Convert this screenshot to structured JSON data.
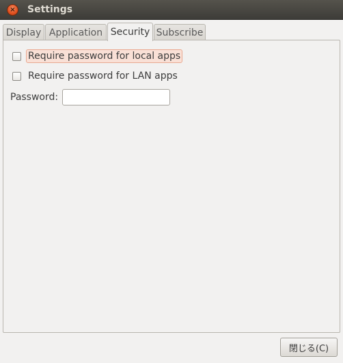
{
  "window": {
    "title": "Settings"
  },
  "tabs": [
    {
      "label": "Display",
      "active": false
    },
    {
      "label": "Application",
      "active": false
    },
    {
      "label": "Security",
      "active": true
    },
    {
      "label": "Subscribe",
      "active": false
    }
  ],
  "security": {
    "local_apps": {
      "label": "Require password for local apps",
      "checked": false
    },
    "lan_apps": {
      "label": "Require password for LAN apps",
      "checked": false
    },
    "password": {
      "label": "Password:",
      "value": ""
    }
  },
  "footer": {
    "close_label": "閉じる(C)"
  },
  "colors": {
    "close_icon": "#e0501f",
    "focus_highlight": "#f9e0d6"
  }
}
